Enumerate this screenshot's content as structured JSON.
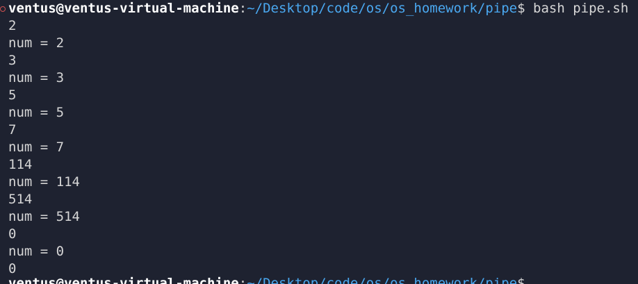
{
  "terminal": {
    "prompt": {
      "user_host": "ventus@ventus-virtual-machine",
      "separator": ":",
      "path": "~/Desktop/code/os/os_homework/pipe",
      "symbol": "$",
      "command": " bash pipe.sh"
    },
    "output_lines": [
      "2",
      "num = 2",
      "3",
      "num = 3",
      "5",
      "num = 5",
      "7",
      "num = 7",
      "114",
      "num = 114",
      "514",
      "num = 514",
      "0",
      "num = 0",
      "0"
    ],
    "next_prompt": {
      "user_host": "ventus@ventus-virtual-machine",
      "separator": ":",
      "path": "~/Desktop/code/os/os_homework/pipe",
      "symbol": "$"
    }
  },
  "colors": {
    "background": "#1e2230",
    "text": "#d6d6d6",
    "user": "#ffffff",
    "path": "#4aa8f0",
    "marker": "#d05050"
  }
}
